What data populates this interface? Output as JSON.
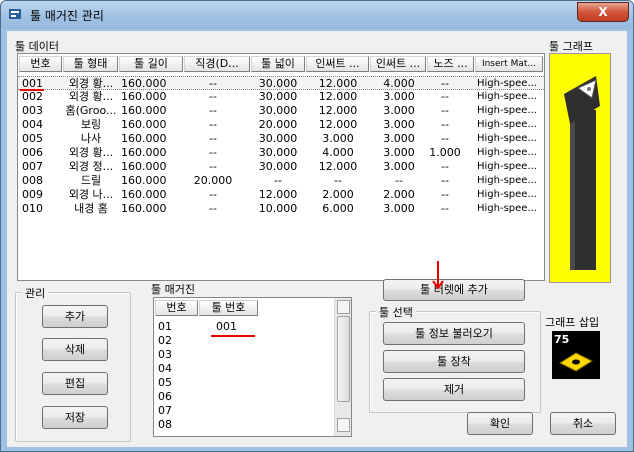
{
  "window": {
    "title": "툴 매거진 관리",
    "close_label": "X"
  },
  "tool_data": {
    "label": "툴 데이터",
    "columns": [
      "번호",
      "툴 형태",
      "툴 길이",
      "직경(D...",
      "툴 넓이",
      "인써트 ...",
      "인써트 ...",
      "노즈 ...",
      "Insert Mat..."
    ],
    "rows": [
      [
        "001",
        "외경 황...",
        "160.000",
        "--",
        "30.000",
        "12.000",
        "4.000",
        "--",
        "High-spee..."
      ],
      [
        "002",
        "외경 황...",
        "160.000",
        "--",
        "30.000",
        "12.000",
        "3.000",
        "--",
        "High-spee..."
      ],
      [
        "003",
        "홈(Groo...",
        "160.000",
        "--",
        "30.000",
        "12.000",
        "3.000",
        "--",
        "High-spee..."
      ],
      [
        "004",
        "보링",
        "160.000",
        "--",
        "20.000",
        "12.000",
        "3.000",
        "--",
        "High-spee..."
      ],
      [
        "005",
        "나사",
        "160.000",
        "--",
        "30.000",
        "3.000",
        "3.000",
        "--",
        "High-spee..."
      ],
      [
        "006",
        "외경 황...",
        "160.000",
        "--",
        "30.000",
        "4.000",
        "3.000",
        "1.000",
        "High-spee..."
      ],
      [
        "007",
        "외경 정...",
        "160.000",
        "--",
        "30.000",
        "12.000",
        "3.000",
        "--",
        "High-spee..."
      ],
      [
        "008",
        "드릴",
        "160.000",
        "20.000",
        "--",
        "--",
        "--",
        "--",
        "High-spee..."
      ],
      [
        "009",
        "외경 나...",
        "160.000",
        "--",
        "12.000",
        "2.000",
        "2.000",
        "--",
        "High-spee..."
      ],
      [
        "010",
        "내경 홈",
        "160.000",
        "--",
        "10.000",
        "6.000",
        "3.000",
        "--",
        "High-spee..."
      ]
    ]
  },
  "tool_graph": {
    "label": "툴 그래프"
  },
  "manage": {
    "label": "관리",
    "add": "추가",
    "delete": "삭제",
    "edit": "편집",
    "save": "저장"
  },
  "magazine": {
    "label": "툴 매거진",
    "columns": [
      "번호",
      "툴 번호"
    ],
    "rows": [
      [
        "01",
        "001"
      ],
      [
        "02",
        ""
      ],
      [
        "03",
        ""
      ],
      [
        "04",
        ""
      ],
      [
        "05",
        ""
      ],
      [
        "06",
        ""
      ],
      [
        "07",
        ""
      ],
      [
        "08",
        ""
      ]
    ]
  },
  "add_to_turret": "툴 터렛에 추가",
  "tool_select": {
    "label": "툴 선택",
    "load_info": "툴 정보 불러오기",
    "mount": "툴 장착",
    "remove": "제거"
  },
  "graph_insert": {
    "label": "그래프 삽입",
    "value": "75"
  },
  "ok": "확인",
  "cancel": "취소"
}
